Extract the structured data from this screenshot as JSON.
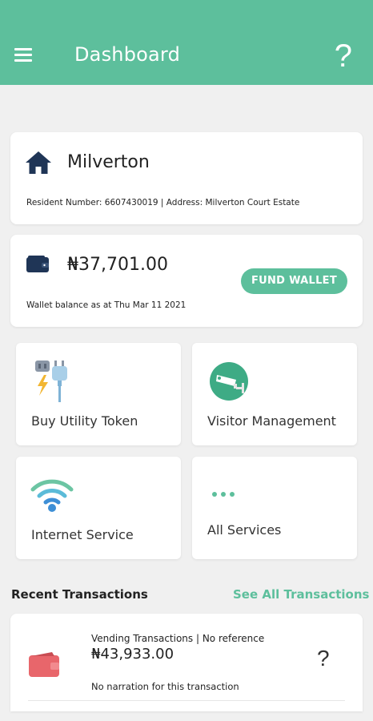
{
  "header": {
    "title": "Dashboard",
    "menu_icon": "hamburger-menu-icon",
    "help_label": "?",
    "background": "#5dbf9c"
  },
  "estate": {
    "name": "Milverton",
    "meta": "Resident Number: 6607430019 | Address: Milverton Court Estate",
    "icon": "house-icon"
  },
  "wallet": {
    "balance": "₦37,701.00",
    "date_text": "Wallet balance as at Thu Mar 11 2021",
    "fund_label": "FUND WALLET",
    "icon": "wallet-icon"
  },
  "services": [
    {
      "label": "Buy Utility Token",
      "icon": "utility-plug-icon"
    },
    {
      "label": "Visitor Management",
      "icon": "cctv-camera-icon"
    },
    {
      "label": "Internet Service",
      "icon": "wifi-icon"
    },
    {
      "label": "All Services",
      "icon": "more-dots-icon"
    }
  ],
  "recent": {
    "title": "Recent Transactions",
    "see_all_label": "See All Transactions",
    "transactions": [
      {
        "type_ref": "Vending Transactions |   No reference",
        "amount": "₦43,933.00",
        "status": "?",
        "narration": "No narration for this transaction",
        "icon": "red-wallet-icon"
      }
    ]
  },
  "colors": {
    "accent": "#5dbf9c",
    "navy": "#1f3556",
    "wallet_red": "#e8666b"
  }
}
